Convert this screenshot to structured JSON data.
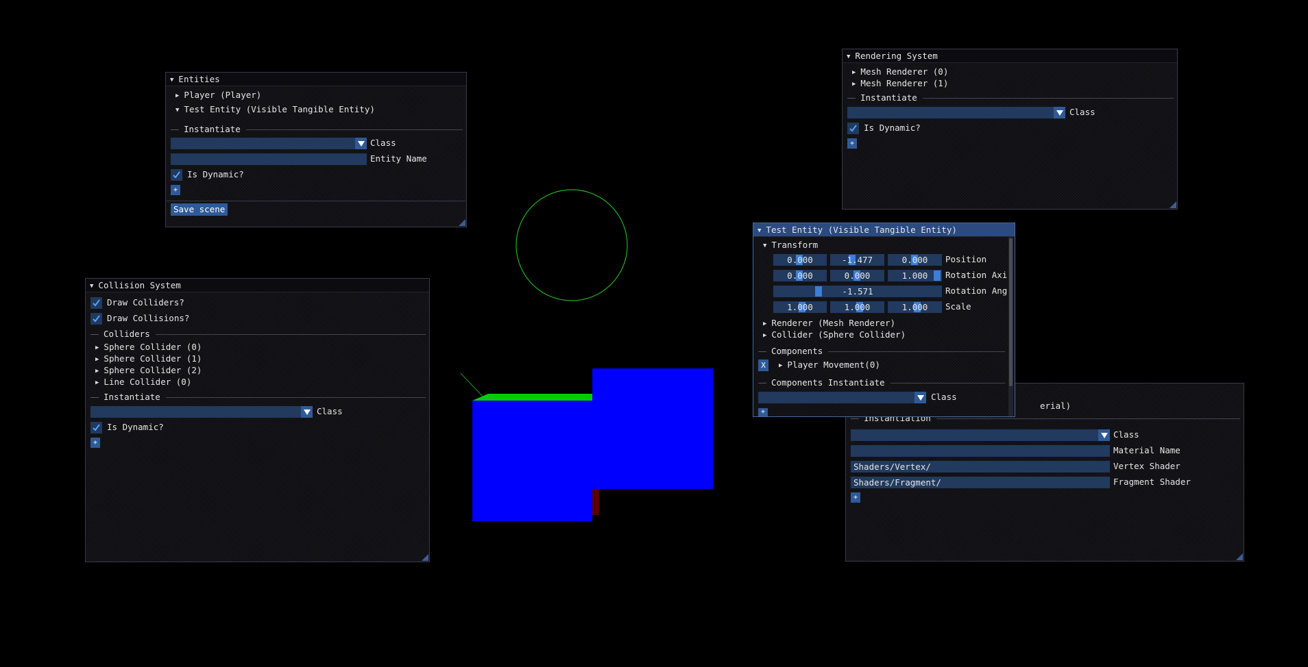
{
  "entities": {
    "title": "Entities",
    "items": [
      "Player (Player)",
      "Test Entity (Visible Tangible Entity)"
    ],
    "instantiate_label": "Instantiate",
    "class_label": "Class",
    "class_value": "",
    "entity_name_label": "Entity Name",
    "entity_name_value": "",
    "is_dynamic_label": "Is Dynamic?",
    "is_dynamic_checked": true,
    "add_label": "+",
    "save_label": "Save scene"
  },
  "collision": {
    "title": "Collision System",
    "draw_colliders_label": "Draw Colliders?",
    "draw_collisions_label": "Draw Collisions?",
    "colliders_label": "Colliders",
    "colliders": [
      "Sphere Collider (0)",
      "Sphere Collider (1)",
      "Sphere Collider (2)",
      "Line Collider (0)"
    ],
    "instantiate_label": "Instantiate",
    "class_label": "Class",
    "is_dynamic_label": "Is Dynamic?",
    "add_label": "+"
  },
  "rendering": {
    "title": "Rendering System",
    "items": [
      "Mesh Renderer (0)",
      "Mesh Renderer (1)"
    ],
    "instantiate_label": "Instantiate",
    "class_label": "Class",
    "is_dynamic_label": "Is Dynamic?",
    "add_label": "+"
  },
  "material": {
    "partial_header": "erial)",
    "instantiation_label": "Instantiation",
    "class_label": "Class",
    "material_name_label": "Material Name",
    "vertex_shader_label": "Vertex Shader",
    "vertex_shader_value": "Shaders/Vertex/",
    "fragment_shader_label": "Fragment Shader",
    "fragment_shader_value": "Shaders/Fragment/",
    "add_label": "+"
  },
  "inspector": {
    "title": "Test Entity (Visible Tangible Entity)",
    "transform_label": "Transform",
    "position": {
      "label": "Position",
      "values": [
        "0.000",
        "-1.477",
        "0.000"
      ]
    },
    "rotation_axis": {
      "label": "Rotation Axi",
      "values": [
        "0.000",
        "0.000",
        "1.000"
      ]
    },
    "rotation_angle": {
      "label": "Rotation Ang",
      "value": "-1.571"
    },
    "scale": {
      "label": "Scale",
      "values": [
        "1.000",
        "1.000",
        "1.000"
      ]
    },
    "renderer_label": "Renderer (Mesh Renderer)",
    "collider_label": "Collider (Sphere Collider)",
    "components_label": "Components",
    "remove_label": "X",
    "player_movement_label": "Player Movement(0)",
    "components_instantiate_label": "Components Instantiate",
    "class_label": "Class",
    "add_label": "+"
  },
  "colors": {
    "accent": "#2f5a97",
    "field": "#213a5e",
    "title_active": "#2a4a80",
    "cube_blue": "#0000ff",
    "cube_green": "#00cc00",
    "circle_green": "#22b022"
  }
}
